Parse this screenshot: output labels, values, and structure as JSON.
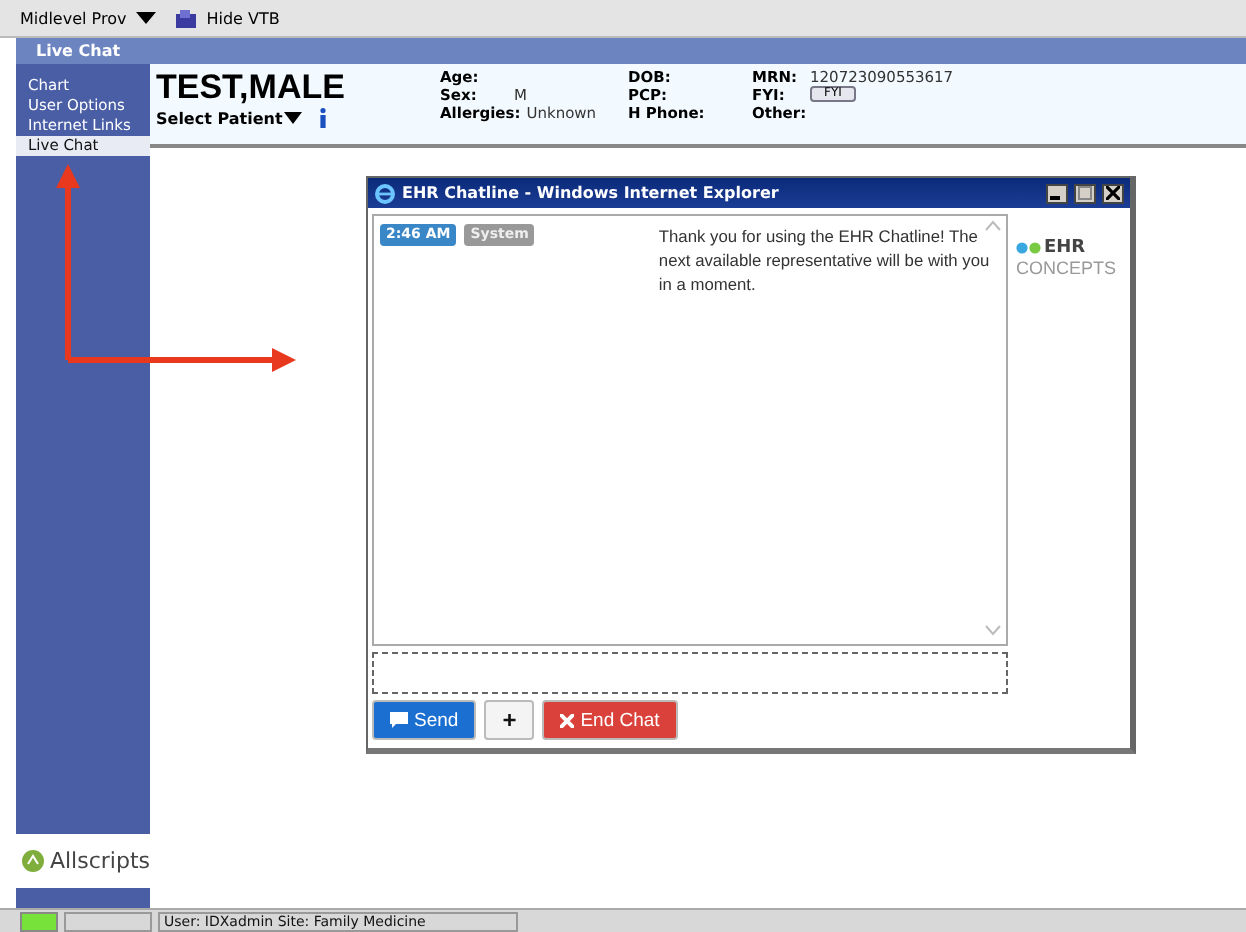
{
  "toolbar": {
    "provider": "Midlevel Prov",
    "hide_button": "Hide VTB"
  },
  "panel_title": "Live Chat",
  "sidebar": {
    "items": [
      {
        "label": "Chart",
        "selected": false
      },
      {
        "label": "User Options",
        "selected": false
      },
      {
        "label": "Internet Links",
        "selected": false
      },
      {
        "label": "Live Chat",
        "selected": true
      }
    ],
    "brand": "Allscripts"
  },
  "patient": {
    "name": "TEST,MALE",
    "select": "Select Patient",
    "columns": [
      [
        {
          "label": "Age:"
        },
        {
          "label": "Sex:",
          "value": "M"
        },
        {
          "label": "Allergies:",
          "value": "Unknown"
        }
      ],
      [
        {
          "label": "DOB:"
        },
        {
          "label": "PCP:"
        },
        {
          "label": "H Phone:"
        }
      ],
      [
        {
          "label": "MRN:",
          "value": "120723090553617"
        },
        {
          "label": "FYI:",
          "button": "FYI"
        },
        {
          "label": "Other:"
        }
      ]
    ]
  },
  "chat_window": {
    "title": "EHR Chatline - Windows Internet Explorer",
    "messages": [
      {
        "time": "2:46 AM",
        "sender": "System",
        "text": "Thank you for using the EHR Chatline! The next available representative will be with you in a moment."
      }
    ],
    "logo": {
      "top": "EHR",
      "bottom": "CONCEPTS"
    },
    "buttons": [
      {
        "kind": "send",
        "label": "Send"
      },
      {
        "kind": "add",
        "label": "+"
      },
      {
        "kind": "end",
        "label": "End Chat"
      }
    ]
  },
  "status_bar": {
    "text": "User: IDXadmin  Site: Family Medicine"
  }
}
